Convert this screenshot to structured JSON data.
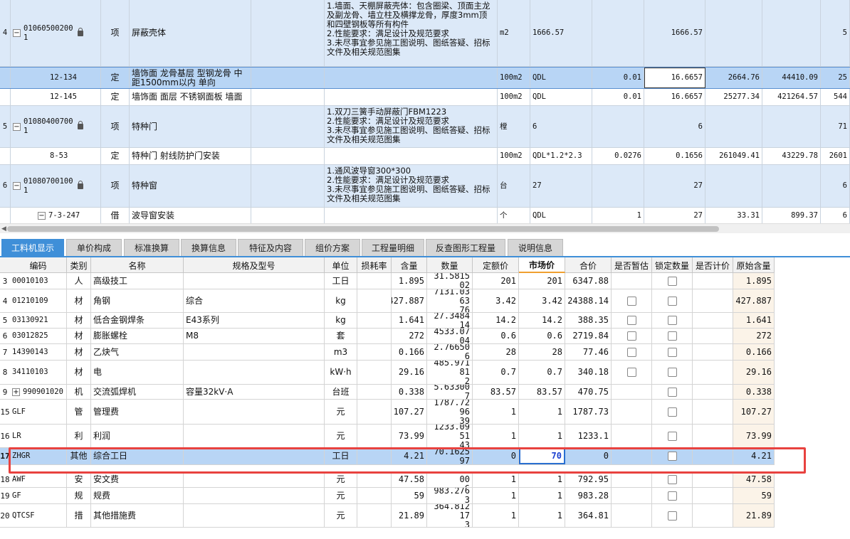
{
  "top_rows": [
    {
      "kind": "item",
      "num": "4",
      "code1": "01060500200",
      "code2": "1",
      "type": "项",
      "name": "屏蔽壳体",
      "feature": "1.墙面、天棚屏蔽壳体：包含圈梁、顶面主龙及副龙骨、墙立柱及横撑龙骨，厚度3mm顶和四壁钢板等所有构件\n2.性能要求：满足设计及规范要求\n3.未尽事宜参见施工图说明、图纸答疑、招标文件及相关规范图集",
      "unit": "m2",
      "qty_expr": "1666.57",
      "coef": "",
      "qty": "1666.57",
      "price": "",
      "total": "",
      "last": "5"
    },
    {
      "kind": "sel",
      "num": "",
      "code1": "12-134",
      "code2": "",
      "type": "定",
      "name": "墙饰面 龙骨基层 型钢龙骨 中距1500mm以内 单向",
      "feature": "",
      "unit": "100m2",
      "qty_expr": "QDL",
      "coef": "0.01",
      "qty": "16.6657",
      "price": "2664.76",
      "total": "44410.09",
      "last": "25"
    },
    {
      "kind": "sub",
      "num": "",
      "code1": "12-145",
      "code2": "",
      "type": "定",
      "name": "墙饰面 面层 不锈钢面板 墙面",
      "feature": "",
      "unit": "100m2",
      "qty_expr": "QDL",
      "coef": "0.01",
      "qty": "16.6657",
      "price": "25277.34",
      "total": "421264.57",
      "last": "544"
    },
    {
      "kind": "item",
      "num": "5",
      "code1": "01080400700",
      "code2": "1",
      "type": "项",
      "name": "特种门",
      "feature": "1.双刀三簧手动屏蔽门FBM1223\n2.性能要求：满足设计及规范要求\n3.未尽事宜参见施工图说明、图纸答疑、招标文件及相关规范图集",
      "unit": "樘",
      "qty_expr": "6",
      "coef": "",
      "qty": "6",
      "price": "",
      "total": "",
      "last": "71"
    },
    {
      "kind": "sub",
      "num": "",
      "code1": "8-53",
      "code2": "",
      "type": "定",
      "name": "特种门 射线防护门安装",
      "feature": "",
      "unit": "100m2",
      "qty_expr": "QDL*1.2*2.3",
      "coef": "0.0276",
      "qty": "0.1656",
      "price": "261049.41",
      "total": "43229.78",
      "last": "2601"
    },
    {
      "kind": "item",
      "num": "6",
      "code1": "01080700100",
      "code2": "1",
      "type": "项",
      "name": "特种窗",
      "feature": "1.通风波导窗300*300\n2.性能要求：满足设计及规范要求\n3.未尽事宜参见施工图说明、图纸答疑、招标文件及相关规范图集",
      "unit": "台",
      "qty_expr": "27",
      "coef": "",
      "qty": "27",
      "price": "",
      "total": "",
      "last": "6"
    },
    {
      "kind": "sub",
      "num": "",
      "code1": "7-3-247",
      "code2": "",
      "type": "借",
      "name": "波导窗安装",
      "feature": "",
      "unit": "个",
      "qty_expr": "QDL",
      "coef": "1",
      "qty": "27",
      "price": "33.31",
      "total": "899.37",
      "last": "6"
    }
  ],
  "tabs": [
    "工料机显示",
    "单价构成",
    "标准换算",
    "换算信息",
    "特征及内容",
    "组价方案",
    "工程量明细",
    "反查图形工程量",
    "说明信息"
  ],
  "bottom_headers": [
    "编码",
    "类别",
    "名称",
    "规格及型号",
    "单位",
    "损耗率",
    "含量",
    "数量",
    "定额价",
    "市场价",
    "合价",
    "是否暂估",
    "锁定数量",
    "是否计价",
    "原始含量"
  ],
  "bottom_rows": [
    {
      "n": "3",
      "code": "00010103",
      "cat": "人",
      "name": "高级技工",
      "spec": "",
      "unit": "工日",
      "loss": "",
      "content": "1.895",
      "qty": "31.581502",
      "base": "201",
      "market": "201",
      "total": "6347.88",
      "est": false,
      "lock": true,
      "orig": "1.895"
    },
    {
      "n": "4",
      "code": "01210109",
      "cat": "材",
      "name": "角钢",
      "spec": "综合",
      "unit": "kg",
      "loss": "",
      "content": "427.887",
      "qty": "7131.0363\n76",
      "base": "3.42",
      "market": "3.42",
      "total": "24388.14",
      "est": true,
      "lock": true,
      "orig": "427.887"
    },
    {
      "n": "5",
      "code": "03130921",
      "cat": "材",
      "name": "低合金钢焊条",
      "spec": "E43系列",
      "unit": "kg",
      "loss": "",
      "content": "1.641",
      "qty": "27.348414",
      "base": "14.2",
      "market": "14.2",
      "total": "388.35",
      "est": true,
      "lock": true,
      "orig": "1.641"
    },
    {
      "n": "6",
      "code": "03012825",
      "cat": "材",
      "name": "膨胀螺栓",
      "spec": "M8",
      "unit": "套",
      "loss": "",
      "content": "272",
      "qty": "4533.0704",
      "base": "0.6",
      "market": "0.6",
      "total": "2719.84",
      "est": true,
      "lock": true,
      "orig": "272"
    },
    {
      "n": "7",
      "code": "14390143",
      "cat": "材",
      "name": "乙炔气",
      "spec": "",
      "unit": "m3",
      "loss": "",
      "content": "0.166",
      "qty": "2.766506",
      "base": "28",
      "market": "28",
      "total": "77.46",
      "est": true,
      "lock": true,
      "orig": "0.166"
    },
    {
      "n": "8",
      "code": "34110103",
      "cat": "材",
      "name": "电",
      "spec": "",
      "unit": "kW·h",
      "loss": "",
      "content": "29.16",
      "qty": "485.97181\n2",
      "base": "0.7",
      "market": "0.7",
      "total": "340.18",
      "est": true,
      "lock": true,
      "orig": "29.16"
    },
    {
      "n": "9",
      "code": "990901020",
      "cat": "机",
      "name": "交流弧焊机",
      "spec": "容量32kV·A",
      "unit": "台班",
      "loss": "",
      "content": "0.338",
      "qty": "5.633007",
      "base": "83.57",
      "market": "83.57",
      "total": "470.75",
      "est": false,
      "lock": true,
      "orig": "0.338",
      "expand": true
    },
    {
      "n": "15",
      "code": "GLF",
      "cat": "管",
      "name": "管理费",
      "spec": "",
      "unit": "元",
      "loss": "",
      "content": "107.27",
      "qty": "1787.7296\n39",
      "base": "1",
      "market": "1",
      "total": "1787.73",
      "est": false,
      "lock": true,
      "orig": "107.27"
    },
    {
      "n": "16",
      "code": "LR",
      "cat": "利",
      "name": "利润",
      "spec": "",
      "unit": "元",
      "loss": "",
      "content": "73.99",
      "qty": "1233.0951\n43",
      "base": "1",
      "market": "1",
      "total": "1233.1",
      "est": false,
      "lock": true,
      "orig": "73.99"
    },
    {
      "n": "17",
      "code": "ZHGR",
      "cat": "其他",
      "name": "综合工日",
      "spec": "",
      "unit": "工日",
      "loss": "",
      "content": "4.21",
      "qty": "70.162597",
      "base": "0",
      "market": "70",
      "total": "0",
      "est": false,
      "lock": true,
      "orig": "4.21",
      "selected": true
    },
    {
      "n": "18",
      "code": "AWF",
      "cat": "安",
      "name": "安文费",
      "spec": "",
      "unit": "元",
      "loss": "",
      "content": "47.58",
      "qty": "792.95400\n6",
      "base": "1",
      "market": "1",
      "total": "792.95",
      "est": false,
      "lock": true,
      "orig": "47.58"
    },
    {
      "n": "19",
      "code": "GF",
      "cat": "规",
      "name": "规费",
      "spec": "",
      "unit": "元",
      "loss": "",
      "content": "59",
      "qty": "983.2763",
      "base": "1",
      "market": "1",
      "total": "983.28",
      "est": false,
      "lock": true,
      "orig": "59"
    },
    {
      "n": "20",
      "code": "QTCSF",
      "cat": "措",
      "name": "其他措施费",
      "spec": "",
      "unit": "元",
      "loss": "",
      "content": "21.89",
      "qty": "364.81217\n3",
      "base": "1",
      "market": "1",
      "total": "364.81",
      "est": false,
      "lock": true,
      "orig": "21.89"
    }
  ],
  "colors": {
    "tab_active": "#3f8fd8",
    "row_selected": "#b8d5f5",
    "item_row": "#dce9f8",
    "highlight_box": "#e8423f"
  }
}
